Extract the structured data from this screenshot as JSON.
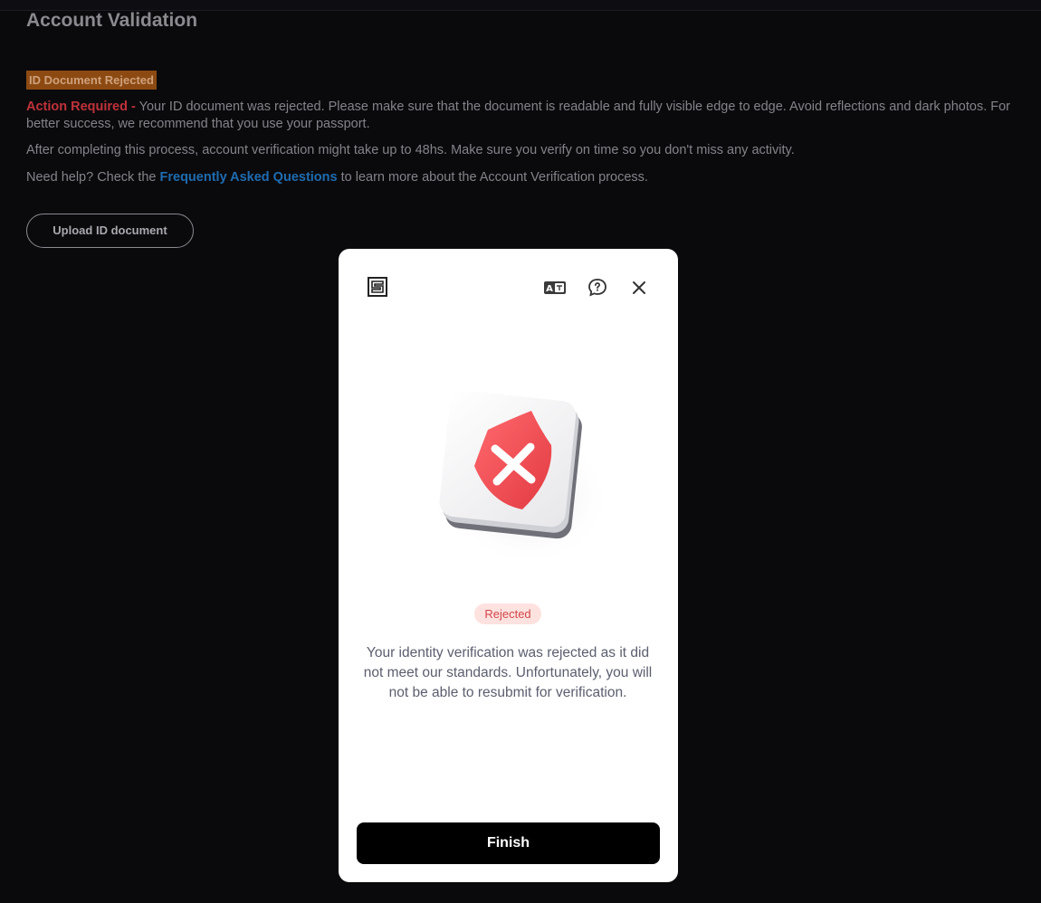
{
  "page": {
    "title": "Account Validation",
    "badge": "ID Document Rejected",
    "action_label": "Action Required -",
    "action_text": " Your ID document was rejected. Please make sure that the document is readable and fully visible edge to edge. Avoid reflections and dark photos. For better success, we recommend that you use your passport.",
    "verification_note": "After completing this process, account verification might take up to 48hs. Make sure you verify on time so you don't miss any activity.",
    "help_prefix": "Need help? Check the ",
    "help_link": "Frequently Asked Questions",
    "help_suffix": " to learn more about the Account Verification process.",
    "upload_button": "Upload ID document"
  },
  "modal": {
    "icons": {
      "logo": "brand-logo-icon",
      "translate": "translate-icon",
      "help": "help-chat-icon",
      "close": "close-icon",
      "illustration": "rejected-shield-icon"
    },
    "status": "Rejected",
    "message": "Your identity verification was rejected as it did not meet our standards. Unfortunately, you will not be able to resubmit for verification.",
    "finish_button": "Finish"
  },
  "colors": {
    "background": "#0a0a0d",
    "badge": "#8c4a12",
    "action_required": "#c0323a",
    "link": "#1f6cb0",
    "rejected_pill": "#fde2df",
    "shield_red": "#f04e55"
  }
}
